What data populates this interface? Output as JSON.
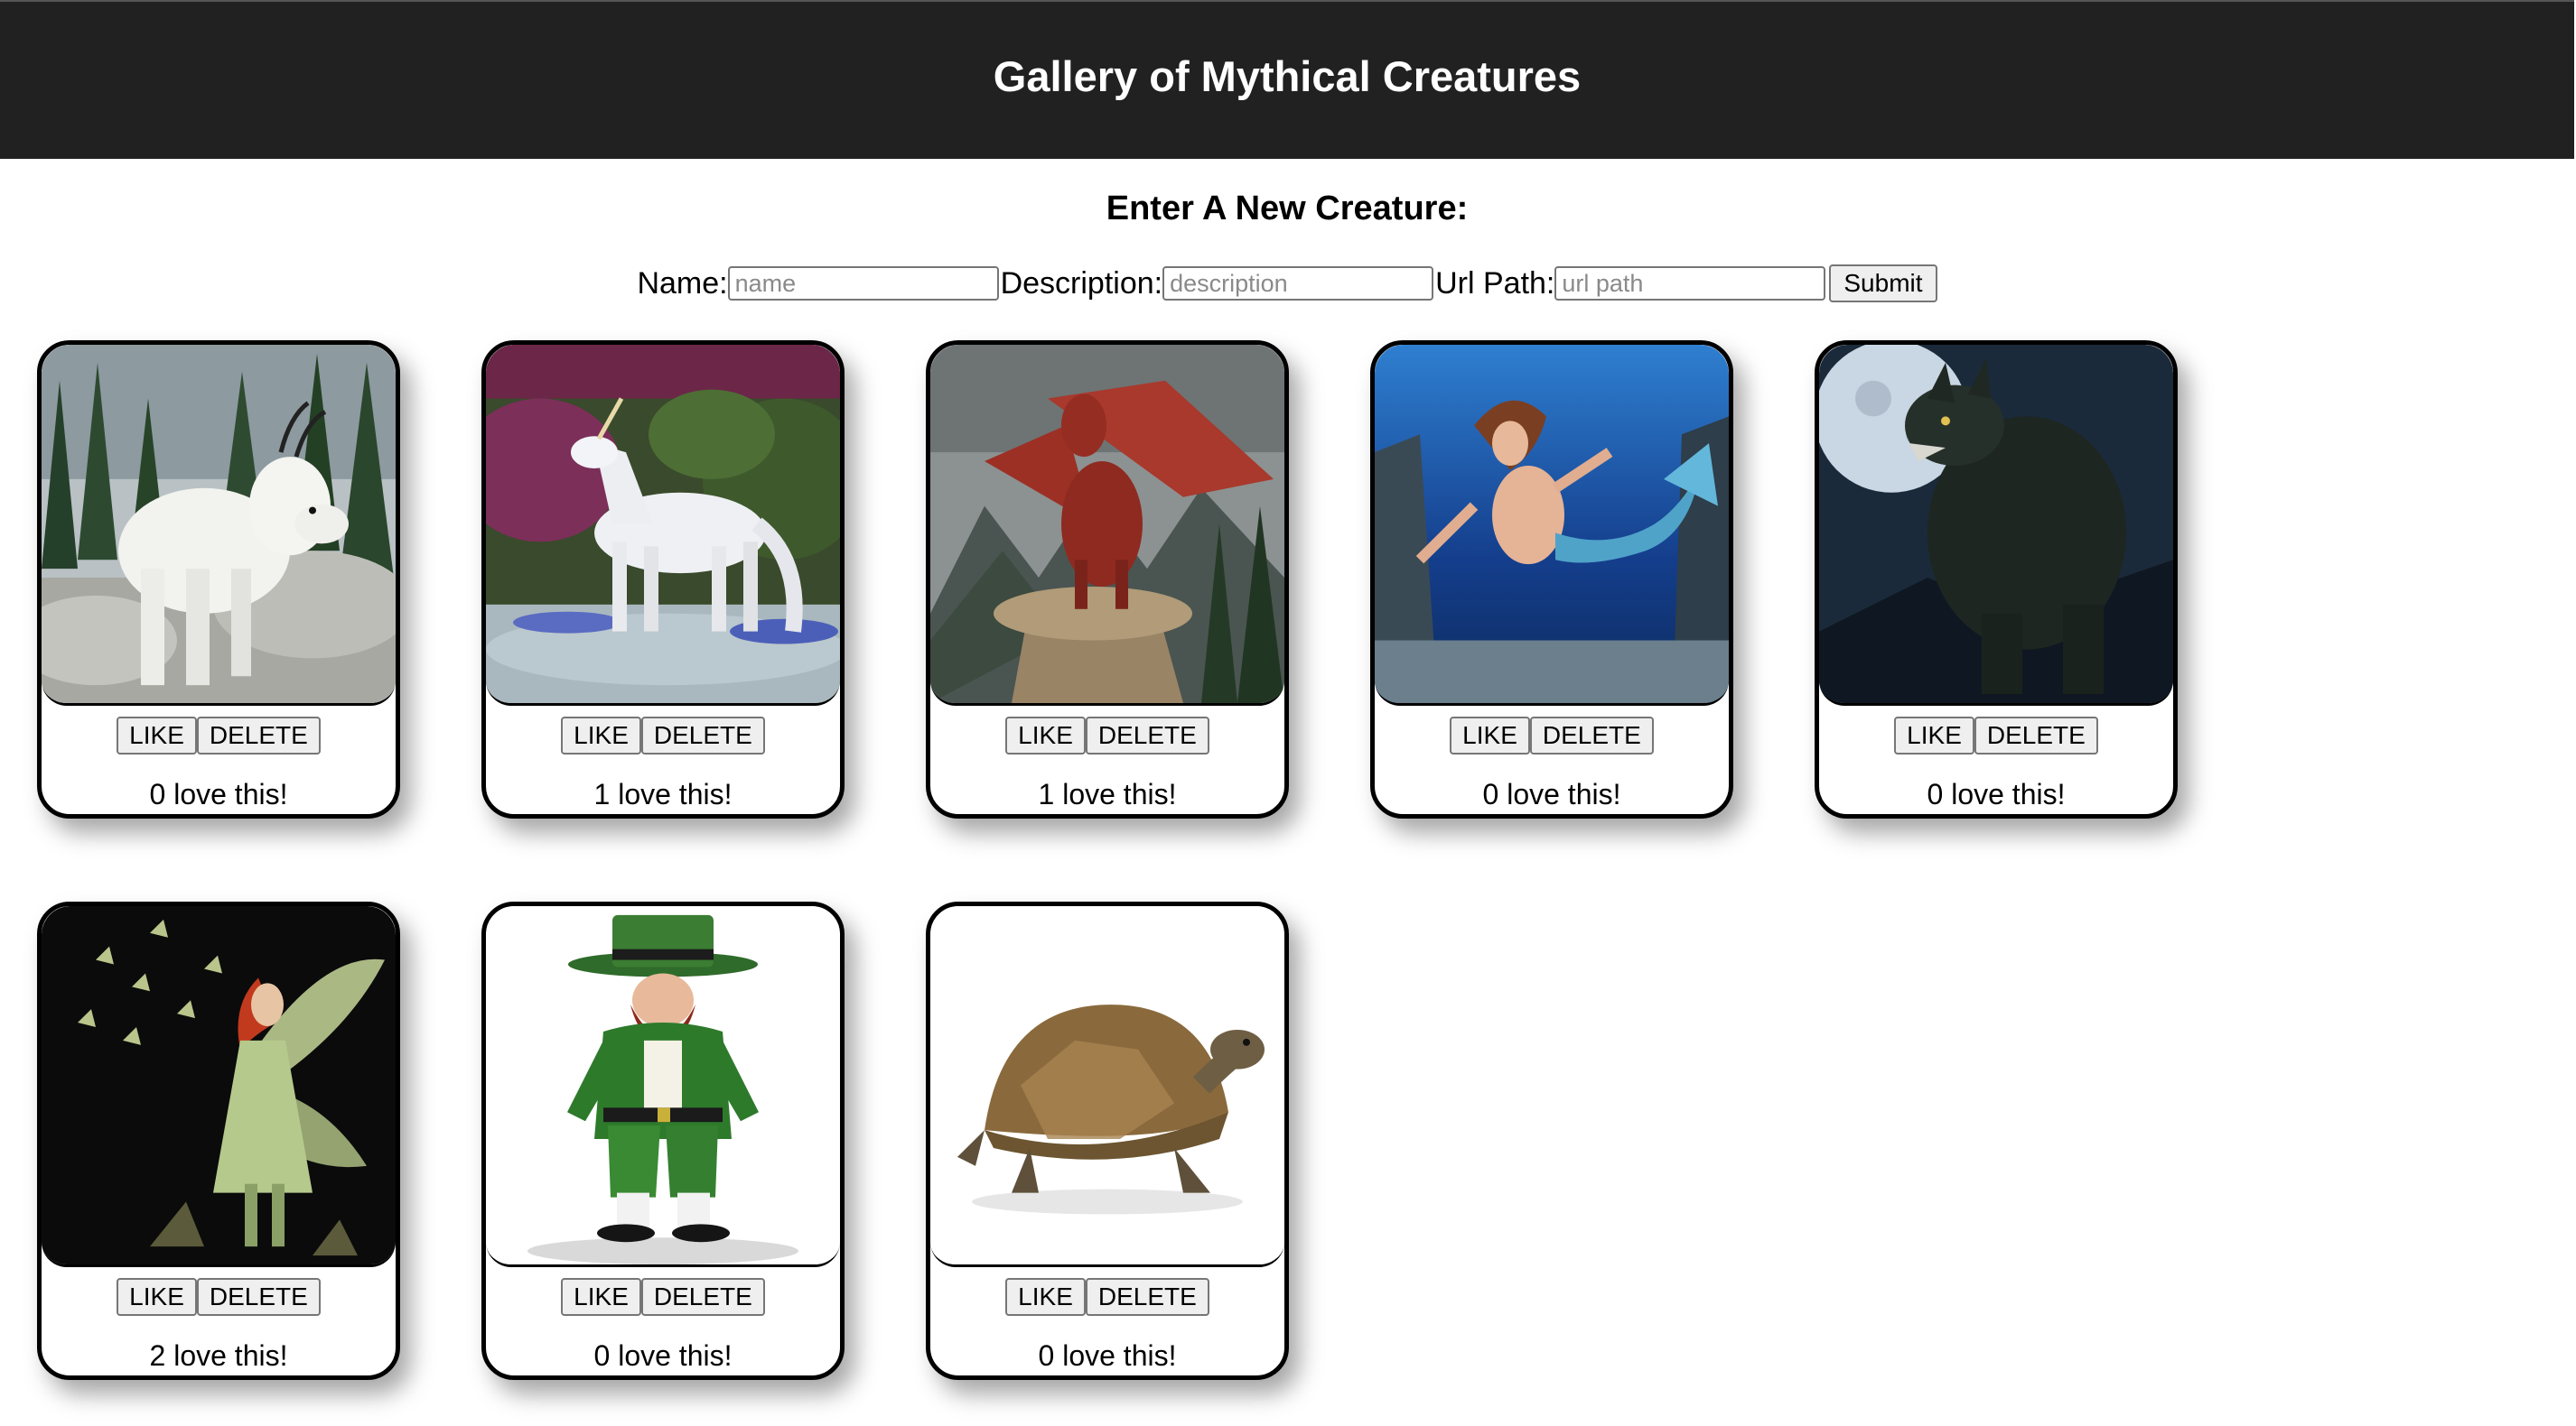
{
  "header": {
    "title": "Gallery of Mythical Creatures"
  },
  "form": {
    "heading": "Enter A New Creature:",
    "name_label": "Name:",
    "name_placeholder": "name",
    "description_label": "Description:",
    "description_placeholder": "description",
    "url_label": "Url Path:",
    "url_placeholder": "url path",
    "submit_label": "Submit"
  },
  "cards": [
    {
      "image": "mountain-goat",
      "like_label": "LIKE",
      "delete_label": "DELETE",
      "love_text": "0 love this!"
    },
    {
      "image": "unicorn",
      "like_label": "LIKE",
      "delete_label": "DELETE",
      "love_text": "1 love this!"
    },
    {
      "image": "dragon",
      "like_label": "LIKE",
      "delete_label": "DELETE",
      "love_text": "1 love this!"
    },
    {
      "image": "mermaid",
      "like_label": "LIKE",
      "delete_label": "DELETE",
      "love_text": "0 love this!"
    },
    {
      "image": "werewolf",
      "like_label": "LIKE",
      "delete_label": "DELETE",
      "love_text": "0 love this!"
    },
    {
      "image": "fairy",
      "like_label": "LIKE",
      "delete_label": "DELETE",
      "love_text": "2 love this!"
    },
    {
      "image": "leprechaun",
      "like_label": "LIKE",
      "delete_label": "DELETE",
      "love_text": "0 love this!"
    },
    {
      "image": "turtle",
      "like_label": "LIKE",
      "delete_label": "DELETE",
      "love_text": "0 love this!"
    }
  ],
  "colors": {
    "header_bg": "#212121",
    "header_text": "#ffffff",
    "card_border": "#000000"
  }
}
